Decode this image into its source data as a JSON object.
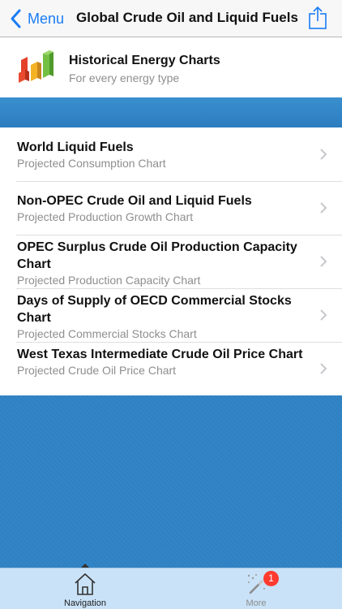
{
  "navbar": {
    "back_label": "Menu",
    "title": "Global Crude Oil and Liquid Fuels"
  },
  "promo": {
    "title": "Historical Energy Charts",
    "subtitle": "For every energy type"
  },
  "list": {
    "items": [
      {
        "title": "World Liquid Fuels",
        "subtitle": "Projected Consumption Chart"
      },
      {
        "title": "Non-OPEC Crude Oil and Liquid Fuels",
        "subtitle": "Projected Production Growth Chart"
      },
      {
        "title": "OPEC Surplus Crude Oil Production Capacity Chart",
        "subtitle": "Projected Production Capacity Chart"
      },
      {
        "title": "Days of Supply of OECD Commercial Stocks Chart",
        "subtitle": "Projected Commercial Stocks Chart"
      },
      {
        "title": "West Texas Intermediate Crude Oil Price Chart",
        "subtitle": "Projected Crude Oil Price Chart"
      }
    ]
  },
  "tabbar": {
    "tabs": [
      {
        "label": "Navigation",
        "icon": "home-icon",
        "selected": true
      },
      {
        "label": "More",
        "icon": "magic-wand-icon",
        "badge": "1"
      }
    ]
  },
  "colors": {
    "accent": "#1a7cf5",
    "background_blue": "#2f7fc0",
    "tabbar": "#c9e2f7",
    "badge": "#ff3b30"
  }
}
